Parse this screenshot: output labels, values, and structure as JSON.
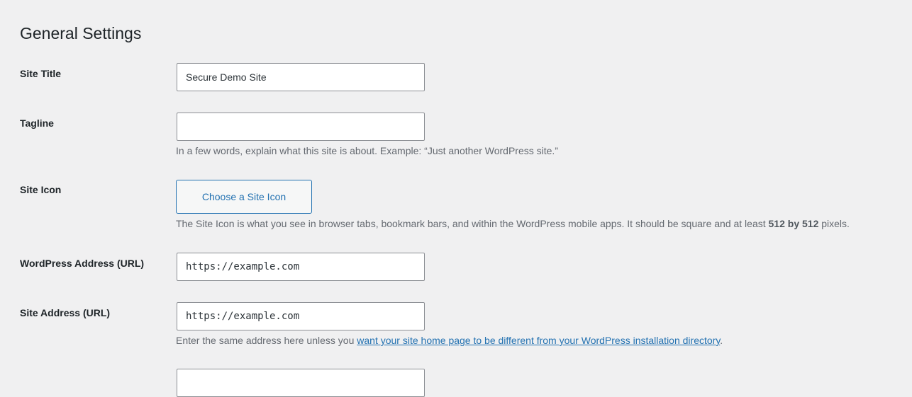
{
  "page": {
    "title": "General Settings"
  },
  "fields": {
    "site_title": {
      "label": "Site Title",
      "value": "Secure Demo Site"
    },
    "tagline": {
      "label": "Tagline",
      "value": "",
      "description": "In a few words, explain what this site is about. Example: “Just another WordPress site.”"
    },
    "site_icon": {
      "label": "Site Icon",
      "button_label": "Choose a Site Icon",
      "description_before": "The Site Icon is what you see in browser tabs, bookmark bars, and within the WordPress mobile apps. It should be square and at least ",
      "description_strong": "512 by 512",
      "description_after": " pixels."
    },
    "wordpress_address": {
      "label": "WordPress Address (URL)",
      "value": "https://example.com"
    },
    "site_address": {
      "label": "Site Address (URL)",
      "value": "https://example.com",
      "description_before": "Enter the same address here unless you ",
      "description_link": "want your site home page to be different from your WordPress installation directory",
      "description_after": "."
    }
  },
  "colors": {
    "background": "#f0f0f1",
    "link": "#2271b1",
    "text": "#1d2327",
    "description": "#646970",
    "input_border": "#8c8f94"
  }
}
